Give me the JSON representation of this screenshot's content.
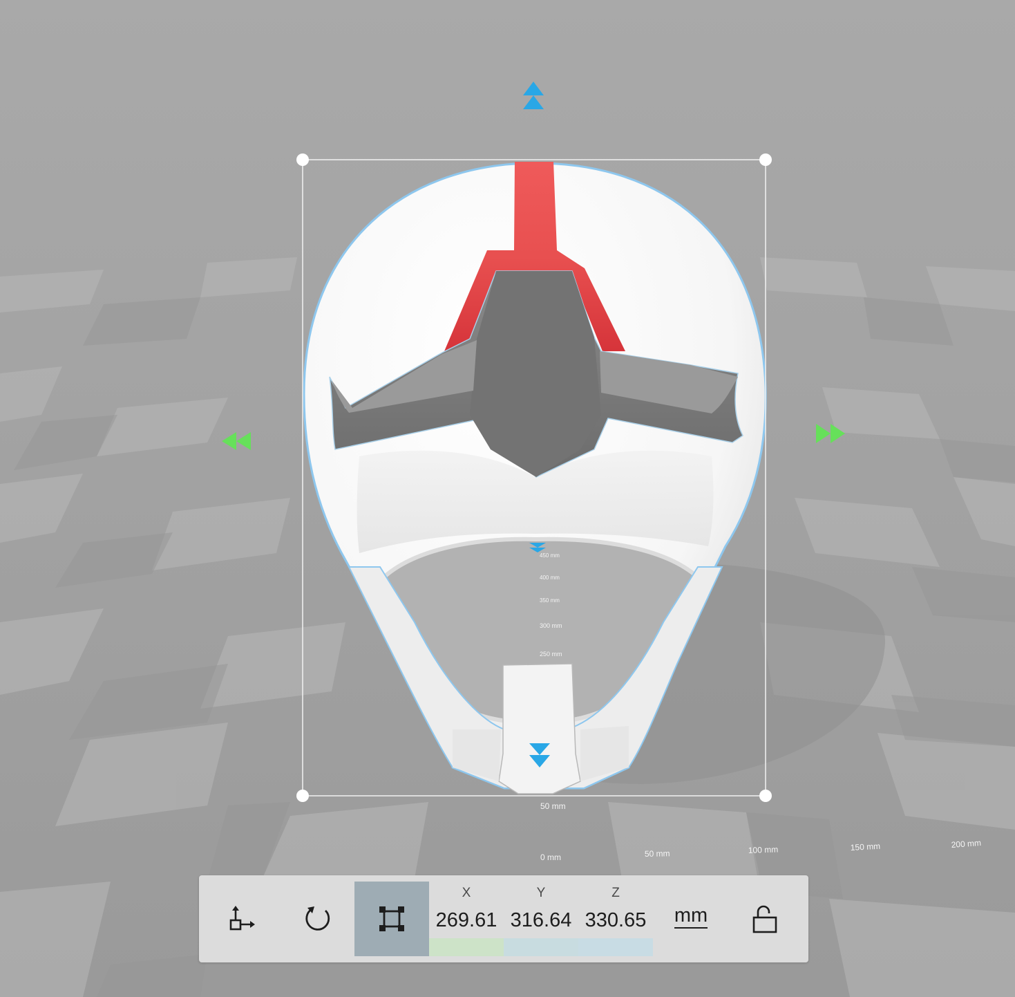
{
  "ruler": {
    "vertical": [
      "450 mm",
      "400 mm",
      "350 mm",
      "300 mm",
      "250 mm",
      "50 mm"
    ],
    "horizontal": [
      "0 mm",
      "50 mm",
      "100 mm",
      "150 mm",
      "200 mm"
    ]
  },
  "toolbar": {
    "tools": [
      {
        "name": "move-tool",
        "icon": "move-icon"
      },
      {
        "name": "rotate-tool",
        "icon": "rotate-icon"
      },
      {
        "name": "scale-tool",
        "icon": "scale-icon",
        "active": true
      }
    ],
    "dimensions": [
      {
        "axis": "X",
        "value": "269.61",
        "color": "#cde3c8"
      },
      {
        "axis": "Y",
        "value": "316.64",
        "color": "#c8dce0"
      },
      {
        "axis": "Z",
        "value": "330.65",
        "color": "#c8dce4"
      }
    ],
    "unit": "mm",
    "lock_icon": "unlocked-padlock-icon"
  },
  "colors": {
    "background": "#a4a4a4",
    "selection_outline": "#8ec7ee",
    "handle_blue": "#29a7e6",
    "handle_green": "#66e05a",
    "accent_red": "#e53a3a"
  }
}
